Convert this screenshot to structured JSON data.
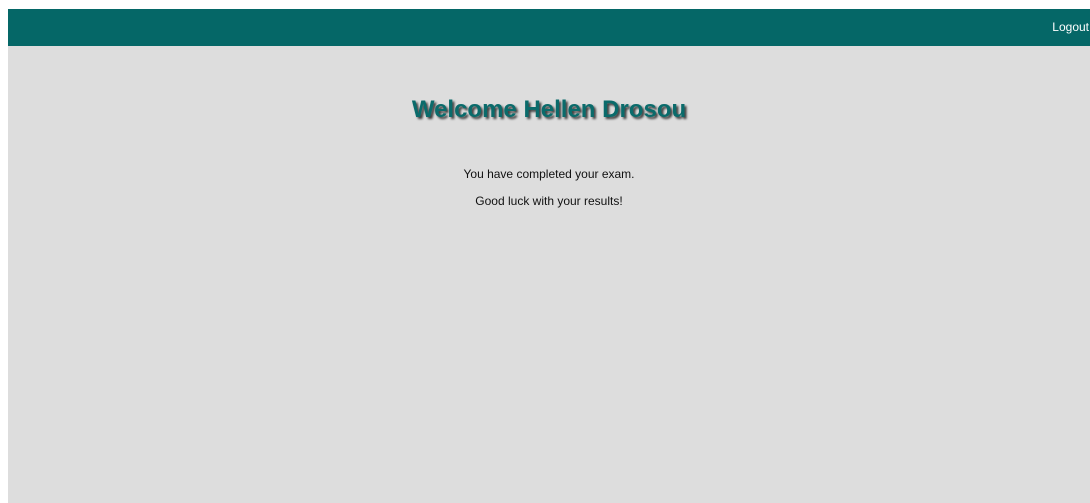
{
  "header": {
    "logout_label": "Logout",
    "bar_color": "#056767"
  },
  "main": {
    "welcome_title": "Welcome Hellen Drosou",
    "completed_message": "You have completed your exam.",
    "good_luck_message": "Good luck with your results!"
  },
  "colors": {
    "page_background": "#dddddd",
    "title_color": "#0a6b6b"
  }
}
